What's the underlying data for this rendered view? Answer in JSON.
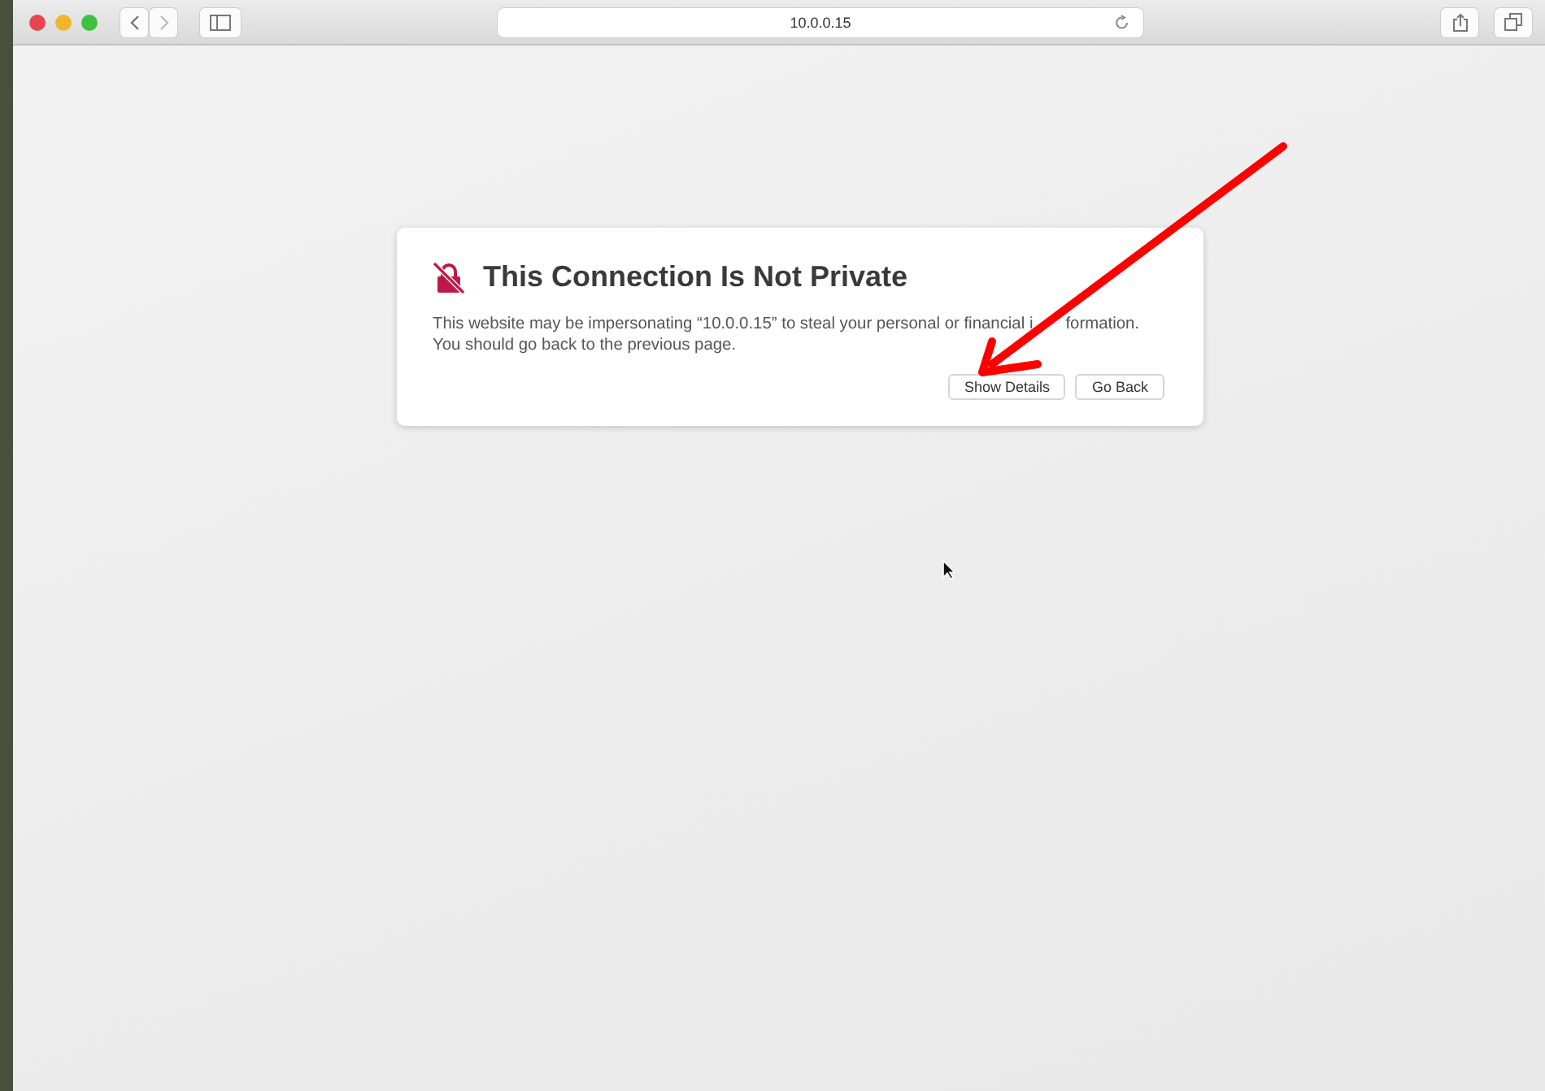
{
  "toolbar": {
    "address": "10.0.0.15"
  },
  "warning": {
    "title": "This Connection Is Not Private",
    "message_line_1": [
      "This website may be impersonating “10.0.0.15” to steal your personal or financial i",
      "formation."
    ],
    "message_line_2": "You should go back to the previous page.",
    "buttons": [
      "Show Details",
      "Go Back"
    ]
  }
}
